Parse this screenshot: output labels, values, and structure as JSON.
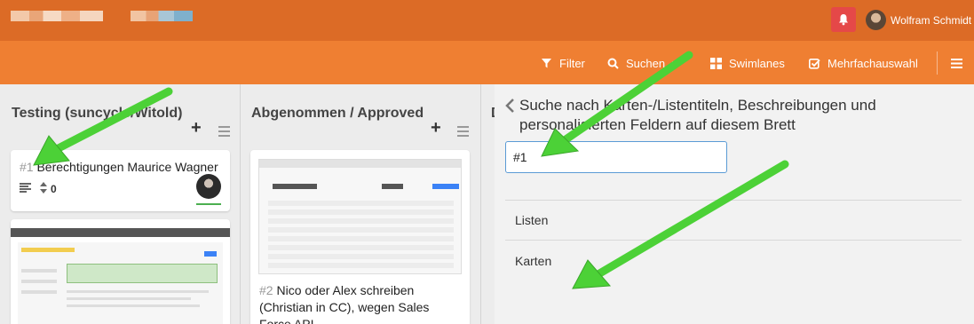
{
  "header": {
    "user_name": "Wolfram Schmidt",
    "bell_icon": "bell-icon"
  },
  "toolbar": {
    "filter_label": "Filter",
    "search_label": "Suchen",
    "swimlanes_label": "Swimlanes",
    "multiselect_label": "Mehrfachauswahl"
  },
  "lists": [
    {
      "title": "Testing (suncycle/Witold)",
      "cards": [
        {
          "number": "#1",
          "title": "Berechtigungen Maurice Wagner",
          "count": "0"
        }
      ]
    },
    {
      "title": "Abgenommen / Approved",
      "cards": [
        {
          "number": "#2",
          "title": "Nico oder Alex schreiben (Christian in CC), wegen Sales Force API..."
        }
      ]
    },
    {
      "title": "D"
    }
  ],
  "search_panel": {
    "title": "Suche nach Karten-/Listentiteln, Beschreibungen und personalisierten Feldern auf diesem Brett",
    "query": "#1",
    "lists_section": "Listen",
    "cards_section": "Karten"
  },
  "colors": {
    "topbar": "#dc6b26",
    "toolbar": "#ef7f32",
    "annotation_arrow": "#4cd137"
  }
}
